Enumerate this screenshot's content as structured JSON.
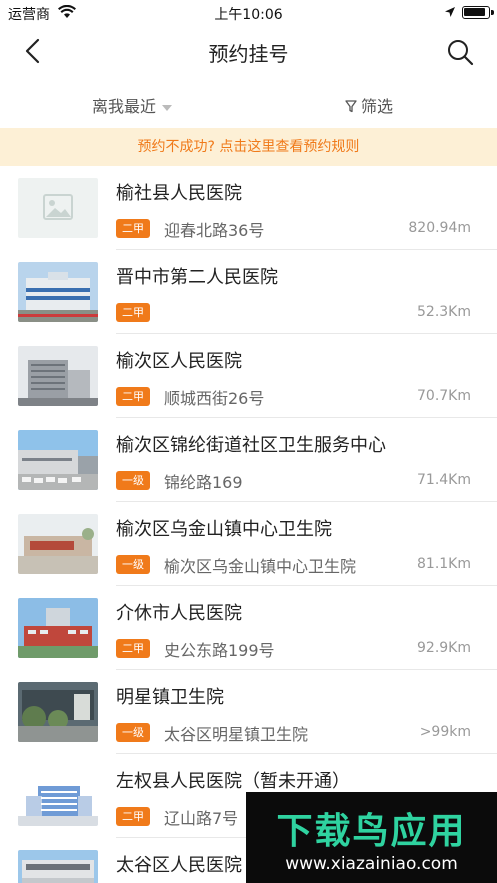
{
  "status_bar": {
    "carrier": "运营商",
    "time": "上午10:06"
  },
  "nav": {
    "title": "预约挂号",
    "back_icon": "chevron-left-icon",
    "search_icon": "search-icon"
  },
  "filters": {
    "sort_label": "离我最近",
    "filter_label": "筛选"
  },
  "notice": "预约不成功? 点击这里查看预约规则",
  "hospitals": [
    {
      "name": "榆社县人民医院",
      "grade": "二甲",
      "address": "迎春北路36号",
      "distance": "820.94m",
      "image": "placeholder"
    },
    {
      "name": "晋中市第二人民医院",
      "grade": "二甲",
      "address": "",
      "distance": "52.3Km",
      "image": "building-blue"
    },
    {
      "name": "榆次区人民医院",
      "grade": "二甲",
      "address": "顺城西街26号",
      "distance": "70.7Km",
      "image": "building-gray"
    },
    {
      "name": "榆次区锦纶街道社区卫生服务中心",
      "grade": "一级",
      "address": "锦纶路169",
      "distance": "71.4Km",
      "image": "building-lot"
    },
    {
      "name": "榆次区乌金山镇中心卫生院",
      "grade": "一级",
      "address": "榆次区乌金山镇中心卫生院",
      "distance": "81.1Km",
      "image": "building-red-sign"
    },
    {
      "name": "介休市人民医院",
      "grade": "二甲",
      "address": "史公东路199号",
      "distance": "92.9Km",
      "image": "building-red"
    },
    {
      "name": "明星镇卫生院",
      "grade": "一级",
      "address": "太谷区明星镇卫生院",
      "distance": ">99km",
      "image": "building-trees"
    },
    {
      "name": "左权县人民医院（暂未开通）",
      "grade": "二甲",
      "address": "辽山路7号",
      "distance": "",
      "image": "building-white"
    },
    {
      "name": "太谷区人民医院",
      "grade": "",
      "address": "",
      "distance": "",
      "image": "building-gate"
    }
  ],
  "watermark": {
    "title": "下载鸟应用",
    "url": "www.xiazainiao.com"
  },
  "colors": {
    "accent": "#f07a1a",
    "notice_bg": "#fdf0d6"
  }
}
